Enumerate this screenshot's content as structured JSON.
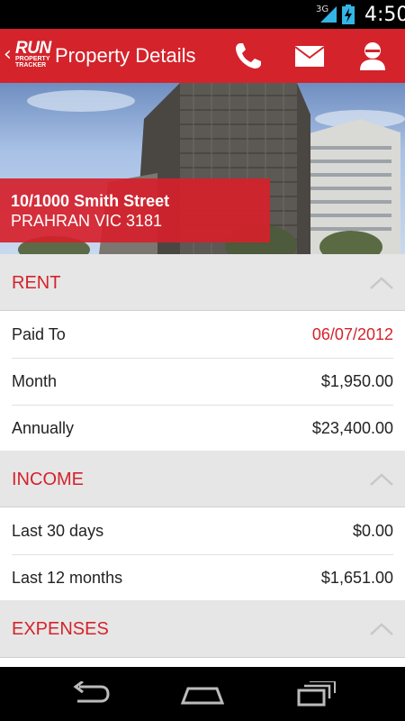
{
  "status_bar": {
    "network": "3G",
    "time": "4:50"
  },
  "action_bar": {
    "logo_top": "RUN",
    "logo_bottom_1": "PROPERTY",
    "logo_bottom_2": "TRACKER",
    "title": "Property Details",
    "icons": [
      "phone-icon",
      "mail-icon",
      "user-icon"
    ],
    "accent_color": "#d4232b"
  },
  "property": {
    "address_line1": "10/1000 Smith Street",
    "address_line2": "PRAHRAN VIC 3181"
  },
  "sections": {
    "rent": {
      "title": "RENT",
      "rows": [
        {
          "label": "Paid To",
          "value": "06/07/2012",
          "highlight": true
        },
        {
          "label": "Month",
          "value": "$1,950.00"
        },
        {
          "label": "Annually",
          "value": "$23,400.00"
        }
      ]
    },
    "income": {
      "title": "INCOME",
      "rows": [
        {
          "label": "Last 30 days",
          "value": "$0.00"
        },
        {
          "label": "Last 12 months",
          "value": "$1,651.00"
        }
      ]
    },
    "expenses": {
      "title": "EXPENSES"
    }
  },
  "nav_bar": {
    "icons": [
      "back-icon",
      "home-icon",
      "recent-apps-icon"
    ]
  }
}
